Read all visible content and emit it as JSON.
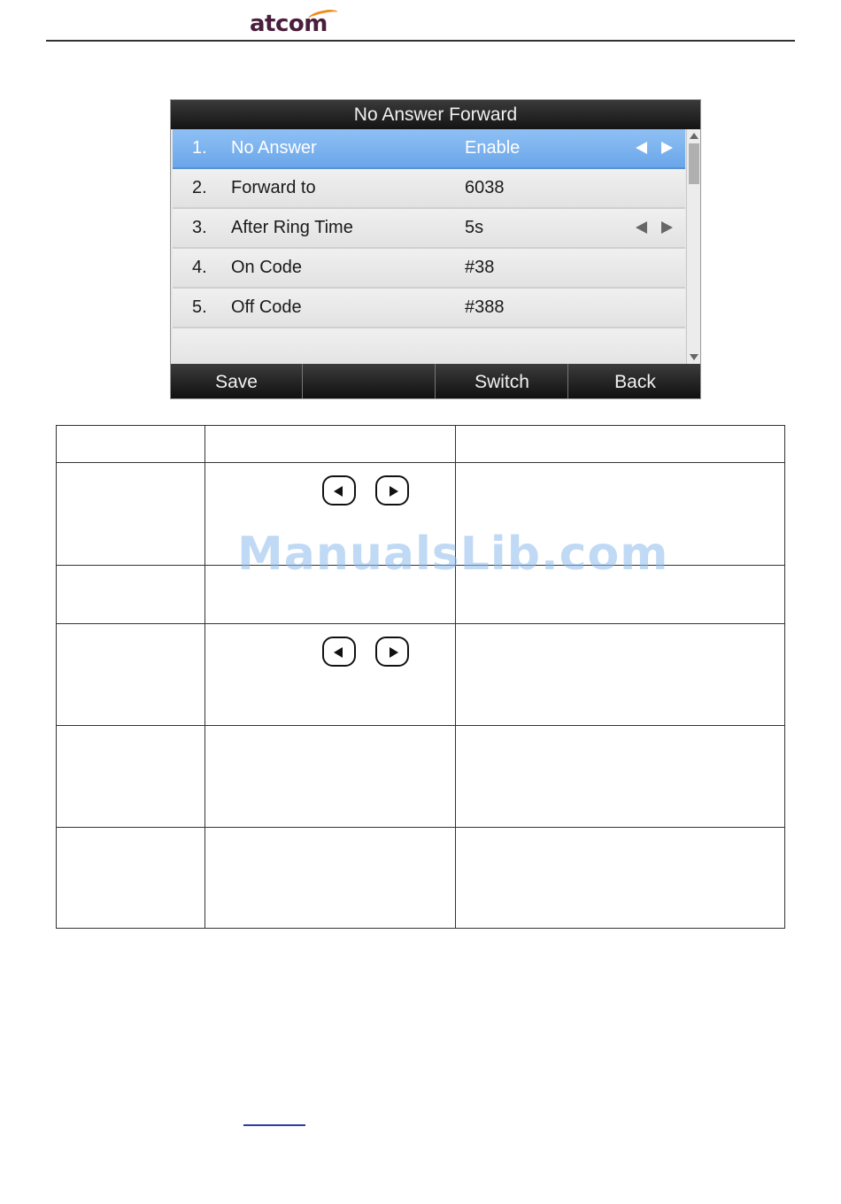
{
  "header": {
    "logo_text": "atcom"
  },
  "screen": {
    "title": "No Answer Forward",
    "rows": [
      {
        "num": "1.",
        "label": "No Answer",
        "value": "Enable",
        "has_arrows": true,
        "selected": true
      },
      {
        "num": "2.",
        "label": "Forward to",
        "value": "6038",
        "has_arrows": false,
        "selected": false
      },
      {
        "num": "3.",
        "label": "After Ring Time",
        "value": "5s",
        "has_arrows": true,
        "selected": false
      },
      {
        "num": "4.",
        "label": "On Code",
        "value": "#38",
        "has_arrows": false,
        "selected": false
      },
      {
        "num": "5.",
        "label": "Off Code",
        "value": "#388",
        "has_arrows": false,
        "selected": false
      }
    ],
    "softkeys": [
      "Save",
      "",
      "Switch",
      "Back"
    ]
  },
  "icons": {
    "left_key": "left-arrow-key-icon",
    "right_key": "right-arrow-key-icon",
    "list_arrows": "left-right-arrow-icon"
  },
  "watermark": {
    "text": "ManualsLib.com"
  },
  "colors": {
    "selected_row": "#6aa6ea",
    "logo": "#4a1f3d",
    "logo_accent": "#f08a1c"
  }
}
